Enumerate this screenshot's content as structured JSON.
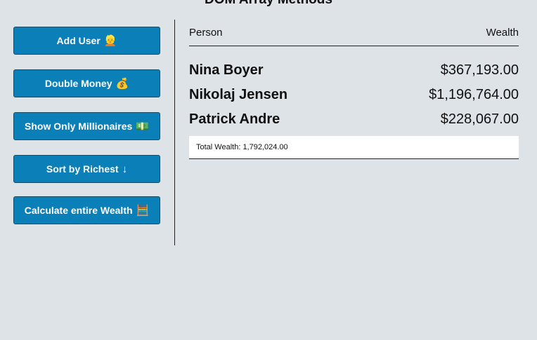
{
  "title": "DOM Array Methods",
  "sidebar": {
    "buttons": [
      {
        "label": "Add User",
        "emoji": "👱"
      },
      {
        "label": "Double Money",
        "emoji": "💰"
      },
      {
        "label": "Show Only Millionaires",
        "emoji": "💵"
      },
      {
        "label": "Sort by Richest",
        "emoji": "↓"
      },
      {
        "label": "Calculate entire Wealth",
        "emoji": "🧮"
      }
    ]
  },
  "main": {
    "headers": {
      "person": "Person",
      "wealth": "Wealth"
    },
    "people": [
      {
        "name": "Nina Boyer",
        "wealth": "$367,193.00"
      },
      {
        "name": "Nikolaj Jensen",
        "wealth": "$1,196,764.00"
      },
      {
        "name": "Patrick Andre",
        "wealth": "$228,067.00"
      }
    ],
    "total": "Total Wealth: 1,792,024.00"
  },
  "colors": {
    "background": "#dde3e7",
    "button": "#0a7fb8",
    "button_text": "#ffffff"
  }
}
